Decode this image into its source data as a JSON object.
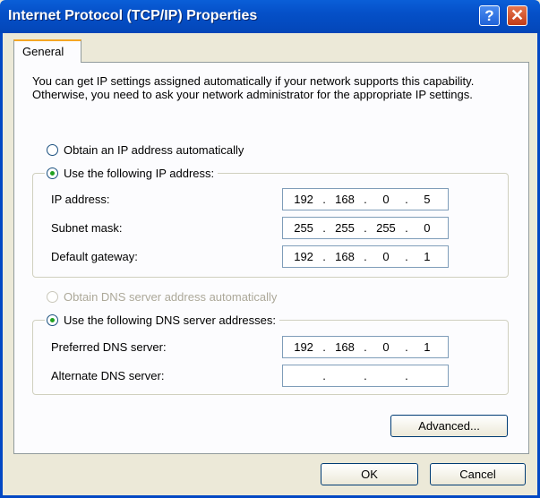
{
  "window": {
    "title": "Internet Protocol (TCP/IP) Properties",
    "help_label": "?",
    "close_label": "✕"
  },
  "tabs": [
    {
      "label": "General"
    }
  ],
  "intro": "You can get IP settings assigned automatically if your network supports this capability. Otherwise, you need to ask your network administrator for the appropriate IP settings.",
  "ip_options": {
    "auto": "Obtain an IP address automatically",
    "manual": "Use the following IP address:",
    "selected": "manual"
  },
  "ip_fields": [
    {
      "label": "IP address:",
      "octets": [
        "192",
        "168",
        "0",
        "5"
      ]
    },
    {
      "label": "Subnet mask:",
      "octets": [
        "255",
        "255",
        "255",
        "0"
      ]
    },
    {
      "label": "Default gateway:",
      "octets": [
        "192",
        "168",
        "0",
        "1"
      ]
    }
  ],
  "dns_options": {
    "auto": "Obtain DNS server address automatically",
    "manual": "Use the following DNS server addresses:",
    "selected": "manual",
    "auto_disabled": true
  },
  "dns_fields": [
    {
      "label": "Preferred DNS server:",
      "octets": [
        "192",
        "168",
        "0",
        "1"
      ]
    },
    {
      "label": "Alternate DNS server:",
      "octets": [
        "",
        "",
        "",
        ""
      ]
    }
  ],
  "buttons": {
    "advanced": "Advanced...",
    "ok": "OK",
    "cancel": "Cancel"
  }
}
